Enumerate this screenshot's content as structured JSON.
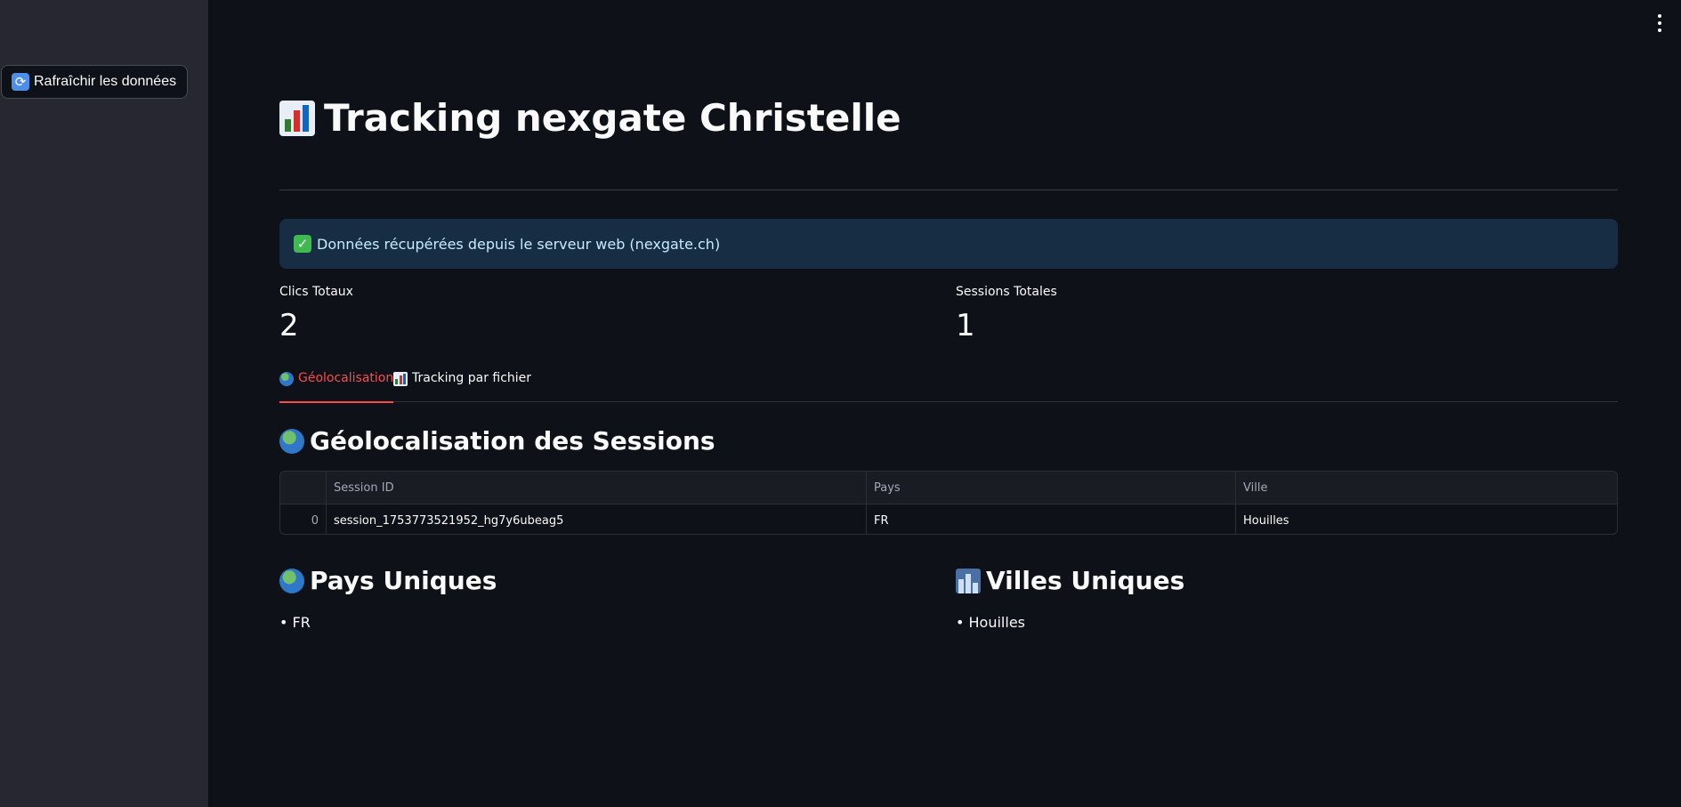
{
  "sidebar": {
    "refresh_button": {
      "icon": "refresh-icon",
      "label": "Rafraîchir les données"
    }
  },
  "header": {
    "menu_icon": "vertical-dots-icon"
  },
  "page": {
    "title": "Tracking nexgate Christelle",
    "title_icon": "bar-chart-icon"
  },
  "alert": {
    "icon": "check-icon",
    "text": "Données récupérées depuis le serveur web (nexgate.ch)"
  },
  "metrics": [
    {
      "label": "Clics Totaux",
      "value": "2"
    },
    {
      "label": "Sessions Totales",
      "value": "1"
    }
  ],
  "tabs": [
    {
      "icon": "globe-icon",
      "label": "Géolocalisation",
      "active": true
    },
    {
      "icon": "bar-chart-icon",
      "label": "Tracking par fichier",
      "active": false
    }
  ],
  "geo_section": {
    "title": "Géolocalisation des Sessions",
    "table": {
      "columns": [
        "",
        "Session ID",
        "Pays",
        "Ville"
      ],
      "rows": [
        {
          "index": "0",
          "session_id": "session_1753773521952_hg7y6ubeag5",
          "pays": "FR",
          "ville": "Houilles"
        }
      ]
    }
  },
  "unique_countries": {
    "title": "Pays Uniques",
    "items": [
      "• FR"
    ]
  },
  "unique_cities": {
    "title": "Villes Uniques",
    "items": [
      "• Houilles"
    ]
  },
  "colors": {
    "background": "#0e1117",
    "sidebar": "#262730",
    "accent": "#ff4b4b",
    "alert_bg": "#172d43",
    "alert_text": "#c7ebff"
  }
}
